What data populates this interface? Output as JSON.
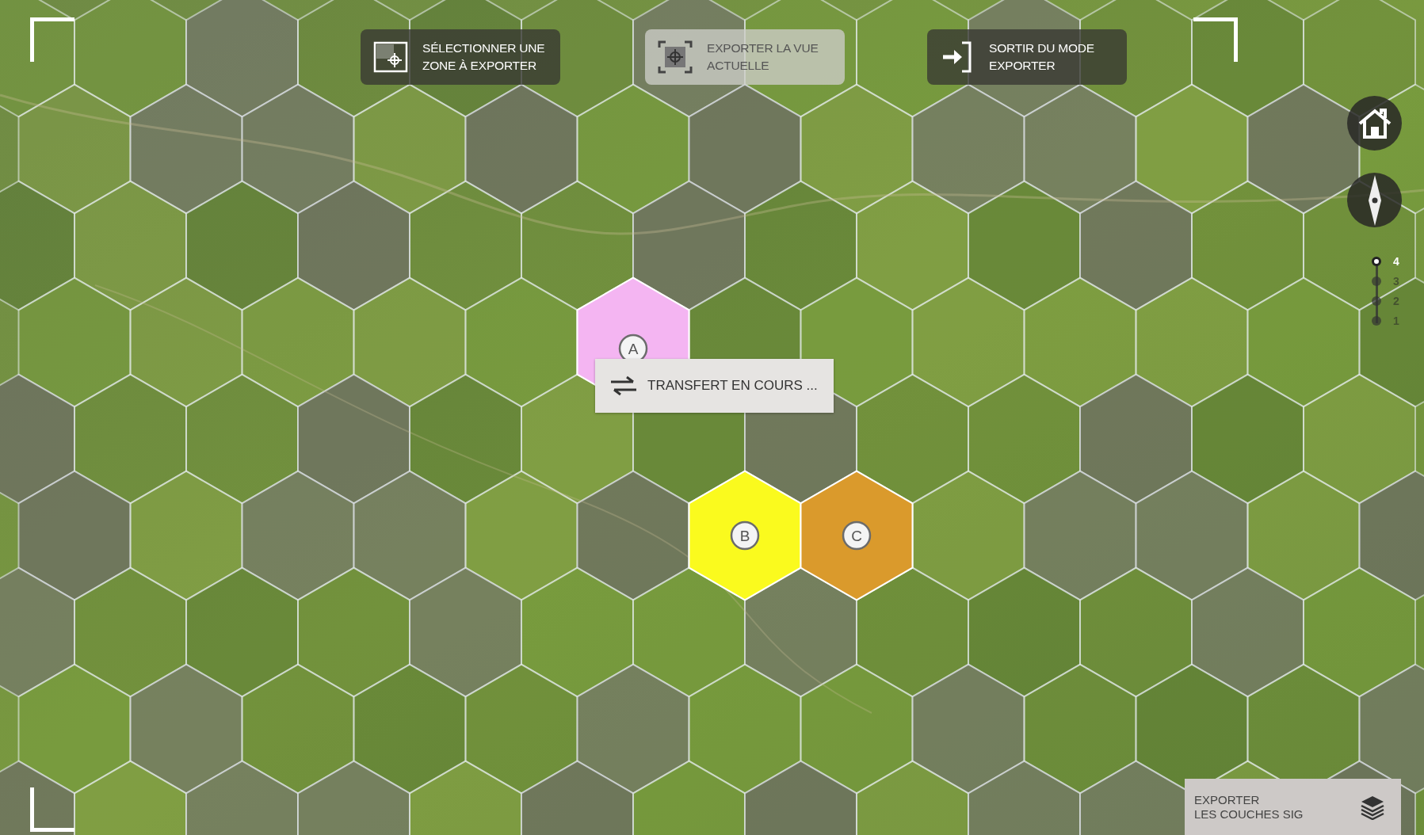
{
  "toolbar": [
    {
      "kind": "select-area",
      "lines": [
        "SÉLECTIONNER UNE",
        "ZONE À EXPORTER"
      ],
      "disabled": false
    },
    {
      "kind": "export-view",
      "lines": [
        "EXPORTER LA VUE",
        "ACTUELLE"
      ],
      "disabled": true
    },
    {
      "kind": "exit",
      "lines": [
        "SORTIR DU MODE",
        "EXPORTER"
      ],
      "disabled": false
    }
  ],
  "zones": [
    {
      "label": "A",
      "color": "#f4b5f2"
    },
    {
      "label": "B",
      "color": "#fafa1e"
    },
    {
      "label": "C",
      "color": "#da9a2c"
    }
  ],
  "zoom_levels": [
    {
      "label": "4",
      "selected": true
    },
    {
      "label": "3",
      "selected": false
    },
    {
      "label": "2",
      "selected": false
    },
    {
      "label": "1",
      "selected": false
    }
  ],
  "status_popup": {
    "text": "TRANSFERT EN COURS ..."
  },
  "export_layers_button": {
    "lines": [
      "EXPORTER",
      "LES COUCHES SIG"
    ]
  }
}
